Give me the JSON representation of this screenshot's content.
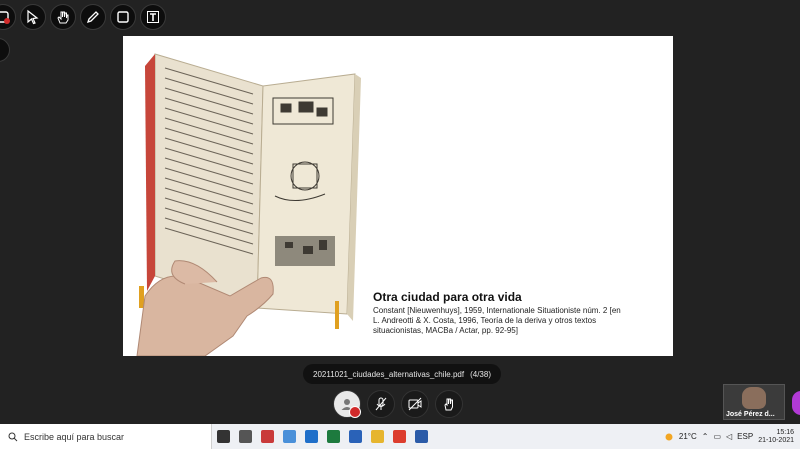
{
  "annotation_toolbar": {
    "tools": [
      {
        "name": "stop-annotation",
        "icon": "record-icon"
      },
      {
        "name": "select",
        "icon": "cursor-icon"
      },
      {
        "name": "hand",
        "icon": "hand-icon"
      },
      {
        "name": "pen",
        "icon": "pen-icon"
      },
      {
        "name": "shape",
        "icon": "square-icon"
      },
      {
        "name": "text",
        "icon": "text-icon"
      }
    ]
  },
  "slide": {
    "title": "Otra ciudad para otra vida",
    "caption": "Constant [Nieuwenhuys], 1959, Internationale Situationiste núm. 2 [en L. Andreotti & X. Costa, 1996, Teoría de la deriva y otros textos situacionistas, MACBa / Actar, pp. 92-95]"
  },
  "file_bar": {
    "filename": "20211021_ciudades_alternativas_chile.pdf",
    "page": "(4/38)"
  },
  "controls": [
    "avatar-mute-icon",
    "mic-off-icon",
    "camera-off-icon",
    "raise-hand-icon"
  ],
  "participant": {
    "name": "José Pérez d..."
  },
  "taskbar": {
    "search_placeholder": "Escribe aquí para buscar",
    "weather": "21°C",
    "language": "ESP",
    "time": "15:16",
    "date": "21-10-2021",
    "app_icons": [
      {
        "icon": "cortana-icon",
        "color": "#333333"
      },
      {
        "icon": "task-view-icon",
        "color": "#555555"
      },
      {
        "icon": "app-icon",
        "color": "#c93a3a"
      },
      {
        "icon": "app-icon",
        "color": "#4a90d9"
      },
      {
        "icon": "outlook-icon",
        "color": "#1f6fc9"
      },
      {
        "icon": "excel-icon",
        "color": "#1d7a3e"
      },
      {
        "icon": "photos-icon",
        "color": "#2a62b8"
      },
      {
        "icon": "file-explorer-icon",
        "color": "#e6b52e"
      },
      {
        "icon": "chrome-icon",
        "color": "#dc3d2e"
      },
      {
        "icon": "word-icon",
        "color": "#2b5ba8"
      }
    ]
  }
}
